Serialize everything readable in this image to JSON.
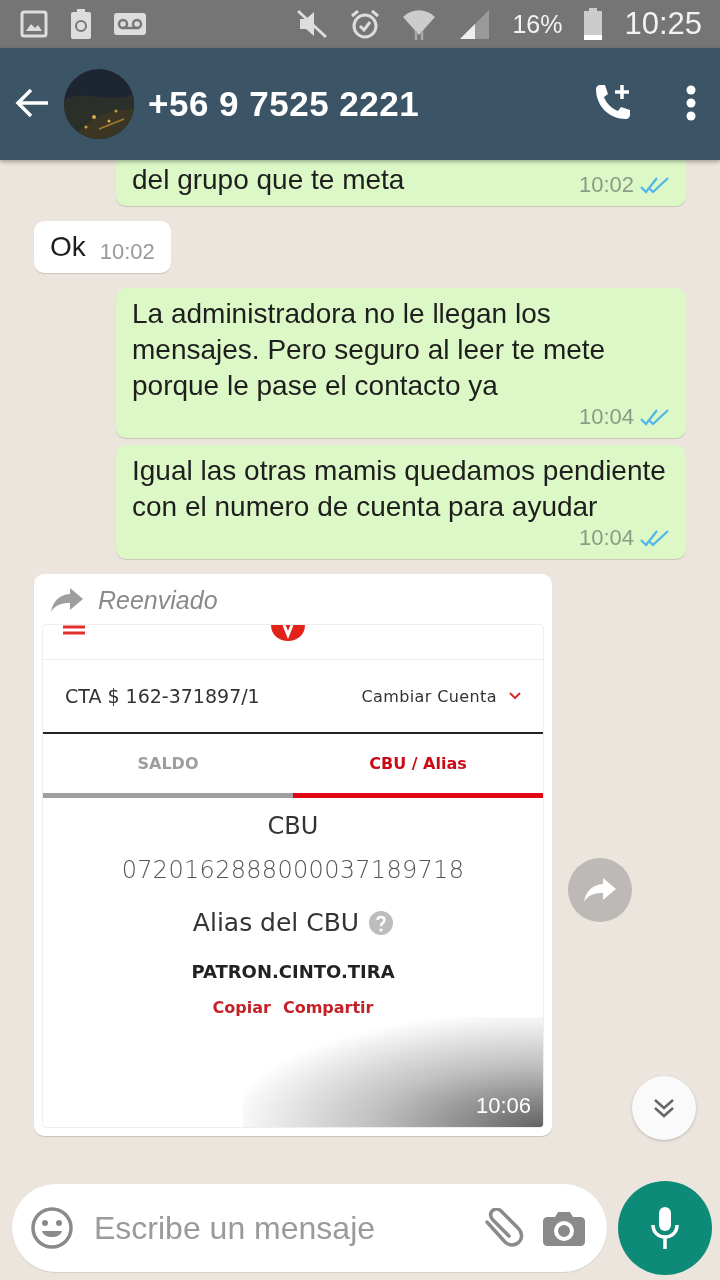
{
  "status_bar": {
    "battery": "16%",
    "time": "10:25"
  },
  "header": {
    "title": "+56 9 7525 2221"
  },
  "messages": [
    {
      "kind": "text",
      "outgoing": true,
      "text": "del grupo que te meta",
      "time": "10:02",
      "read": true
    },
    {
      "kind": "text",
      "outgoing": false,
      "text": "Ok",
      "time": "10:02"
    },
    {
      "kind": "text",
      "outgoing": true,
      "text": "La administradora no le llegan los mensajes. Pero seguro al leer te mete porque le pase el contacto ya",
      "time": "10:04",
      "read": true
    },
    {
      "kind": "text",
      "outgoing": true,
      "text": "Igual las otras mamis quedamos pendiente con el numero de cuenta para ayudar",
      "time": "10:04",
      "read": true
    },
    {
      "outgoing": false,
      "forwarded": "Reenviado",
      "time": "10:06",
      "screenshot": {
        "account": "CTA $ 162-371897/1",
        "change_account": "Cambiar Cuenta",
        "tabs": [
          {
            "label": "SALDO",
            "selected": false
          },
          {
            "label": "CBU / Alias",
            "selected": true
          }
        ],
        "cbu_label": "CBU",
        "cbu": "0720162888000037189718",
        "alias_label": "Alias del CBU",
        "alias": "PATRON.CINTO.TIRA",
        "actions": [
          "Copiar",
          "Compartir"
        ]
      }
    }
  ],
  "composer": {
    "placeholder": "Escribe un mensaje"
  }
}
